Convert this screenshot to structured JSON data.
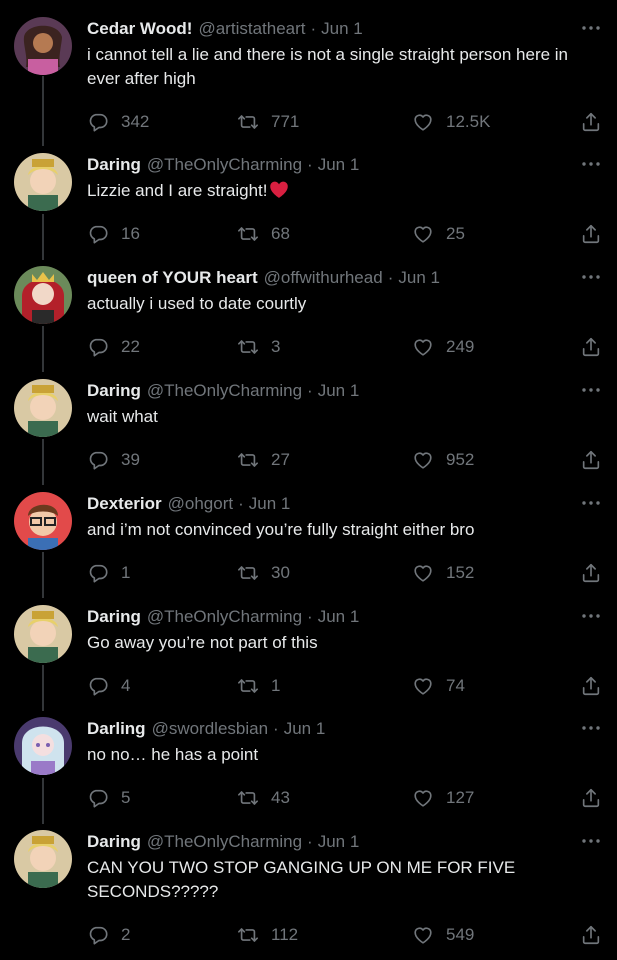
{
  "colors": {
    "background": "#000000",
    "text": "#e7e9ea",
    "muted": "#71767b",
    "thread_line": "#333639",
    "heart": "#d81f40"
  },
  "icons": [
    "reply-icon",
    "retweet-icon",
    "like-icon",
    "share-icon",
    "more-icon",
    "red-heart-emoji"
  ],
  "tweets": [
    {
      "name": "Cedar Wood!",
      "handle": "@artistatheart",
      "date": "Jun 1",
      "text_lines": [
        "i cannot tell a lie and there is not a single straight person here in",
        "ever after high"
      ],
      "replies": "342",
      "retweets": "771",
      "likes": "12.5K"
    },
    {
      "name": "Daring",
      "handle": "@TheOnlyCharming",
      "date": "Jun 1",
      "text_lines": [
        "Lizzie and I are straight!"
      ],
      "replies": "16",
      "retweets": "68",
      "likes": "25"
    },
    {
      "name": "queen of YOUR heart",
      "handle": "@offwithurhead",
      "date": "Jun 1",
      "text_lines": [
        "actually i used to date courtly"
      ],
      "replies": "22",
      "retweets": "3",
      "likes": "249"
    },
    {
      "name": "Daring",
      "handle": "@TheOnlyCharming",
      "date": "Jun 1",
      "text_lines": [
        "wait what"
      ],
      "replies": "39",
      "retweets": "27",
      "likes": "952"
    },
    {
      "name": "Dexterior",
      "handle": "@ohgort",
      "date": "Jun 1",
      "text_lines": [
        "and i’m not convinced you’re fully straight either bro"
      ],
      "replies": "1",
      "retweets": "30",
      "likes": "152"
    },
    {
      "name": "Daring",
      "handle": "@TheOnlyCharming",
      "date": "Jun 1",
      "text_lines": [
        "Go away you’re not part of this"
      ],
      "replies": "4",
      "retweets": "1",
      "likes": "74"
    },
    {
      "name": "Darling",
      "handle": "@swordlesbian",
      "date": "Jun 1",
      "text_lines": [
        "no no… he has a point"
      ],
      "replies": "5",
      "retweets": "43",
      "likes": "127"
    },
    {
      "name": "Daring",
      "handle": "@TheOnlyCharming",
      "date": "Jun 1",
      "text_lines": [
        "CAN YOU TWO STOP GANGING UP ON ME FOR FIVE",
        "SECONDS?????"
      ],
      "replies": "2",
      "retweets": "112",
      "likes": "549"
    }
  ]
}
